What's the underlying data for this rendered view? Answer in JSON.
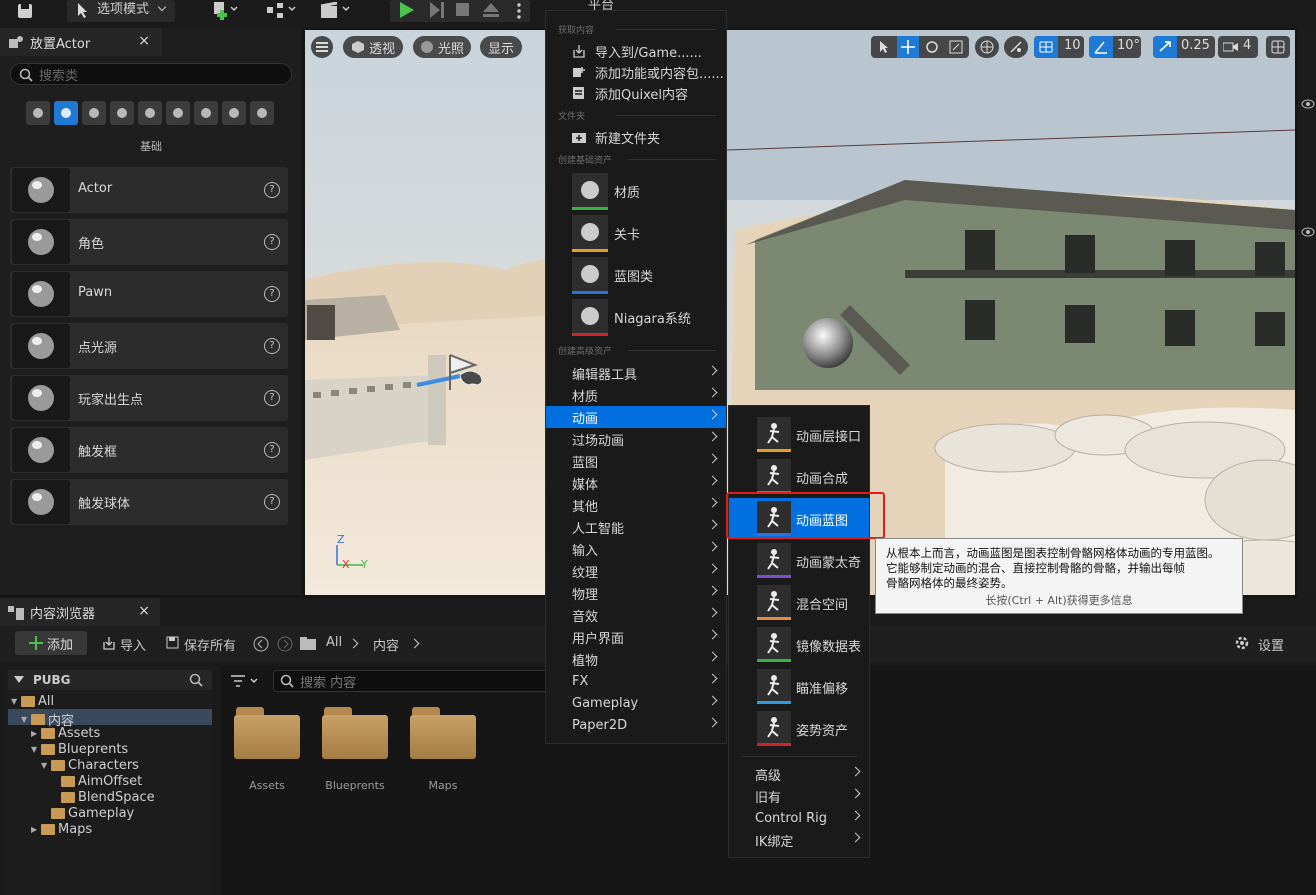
{
  "toolbar": {
    "mode_label": "选项模式",
    "platform_label": "平台"
  },
  "place_actor": {
    "tab_title": "放置Actor",
    "search_placeholder": "搜索类",
    "category_label": "基础",
    "categories": [
      "recent-icon",
      "basic-icon",
      "lights-icon",
      "shapes-icon",
      "cinematic-icon",
      "visual-effects-icon",
      "volumes-icon",
      "all-classes-icon",
      "geometry-icon"
    ],
    "items": [
      {
        "label": "Actor",
        "icon": "sphere-actor-icon"
      },
      {
        "label": "角色",
        "icon": "character-head-icon"
      },
      {
        "label": "Pawn",
        "icon": "pawn-icon"
      },
      {
        "label": "点光源",
        "icon": "lightbulb-icon"
      },
      {
        "label": "玩家出生点",
        "icon": "player-start-flag-icon"
      },
      {
        "label": "触发框",
        "icon": "trigger-box-icon"
      },
      {
        "label": "触发球体",
        "icon": "trigger-sphere-icon"
      }
    ]
  },
  "viewport": {
    "menu_icon": "hamburger-icon",
    "perspective_label": "透视",
    "lit_label": "光照",
    "show_label": "显示",
    "grid_value": "10",
    "rotation_value": "10°",
    "scale_value": "0.25",
    "camera_speed_value": "4",
    "axis_z": "Z",
    "axis_x": "X",
    "axis_y": "Y"
  },
  "content_browser": {
    "tab_title": "内容浏览器",
    "add_label": "添加",
    "import_label": "导入",
    "save_all_label": "保存所有",
    "crumbs": [
      "All",
      "内容"
    ],
    "settings_label": "设置",
    "project_name": "PUBG",
    "search_placeholder": "搜索 内容",
    "tree": [
      {
        "label": "All",
        "depth": 0,
        "expanded": true
      },
      {
        "label": "内容",
        "depth": 1,
        "expanded": true,
        "selected": true
      },
      {
        "label": "Assets",
        "depth": 2,
        "expanded": false
      },
      {
        "label": "Blueprents",
        "depth": 2,
        "expanded": true
      },
      {
        "label": "Characters",
        "depth": 3,
        "expanded": true
      },
      {
        "label": "AimOffset",
        "depth": 4
      },
      {
        "label": "BlendSpace",
        "depth": 4
      },
      {
        "label": "Gameplay",
        "depth": 3
      },
      {
        "label": "Maps",
        "depth": 2,
        "expanded": false
      }
    ],
    "folders": [
      "Assets",
      "Blueprents",
      "Maps"
    ]
  },
  "add_menu": {
    "section_get_content": "获取内容",
    "import_to": "导入到/Game......",
    "add_feature": "添加功能或内容包......",
    "add_quixel": "添加Quixel内容",
    "section_folder": "文件夹",
    "new_folder": "新建文件夹",
    "section_basic": "创建基础资产",
    "basic_assets": [
      {
        "label": "材质",
        "color": "#3cb043"
      },
      {
        "label": "关卡",
        "color": "#e5a021"
      },
      {
        "label": "蓝图类",
        "color": "#2c6fe0"
      },
      {
        "label": "Niagara系统",
        "color": "#d0252b"
      }
    ],
    "section_advanced": "创建高级资产",
    "advanced_items": [
      "编辑器工具",
      "材质",
      "动画",
      "过场动画",
      "蓝图",
      "媒体",
      "其他",
      "人工智能",
      "输入",
      "纹理",
      "物理",
      "音效",
      "用户界面",
      "植物",
      "FX",
      "Gameplay",
      "Paper2D"
    ],
    "highlighted_item": "动画"
  },
  "anim_menu": {
    "items": [
      {
        "label": "动画层接口",
        "color": "#e5a021",
        "icon": "anim-layer-interface-icon"
      },
      {
        "label": "动画合成",
        "color": "#3a86e8",
        "icon": "anim-montage-composite-icon"
      },
      {
        "label": "动画蓝图",
        "color": "#2c6fe0",
        "icon": "anim-blueprint-icon",
        "highlighted": true
      },
      {
        "label": "动画蒙太奇",
        "color": "#7b4fd6",
        "icon": "anim-montage-icon"
      },
      {
        "label": "混合空间",
        "color": "#e58c45",
        "icon": "blend-space-icon"
      },
      {
        "label": "镜像数据表",
        "color": "#3cb043",
        "icon": "mirror-table-icon"
      },
      {
        "label": "瞄准偏移",
        "color": "#2c9be0",
        "icon": "aim-offset-icon"
      },
      {
        "label": "姿势资产",
        "color": "#d0252b",
        "icon": "pose-asset-icon"
      }
    ],
    "sub_items": [
      "高级",
      "旧有",
      "Control Rig",
      "IK绑定"
    ]
  },
  "tooltip": {
    "line1": "从根本上而言，动画蓝图是图表控制骨骼网格体动画的专用蓝图。",
    "line2": "它能够制定动画的混合、直接控制骨骼的骨骼，并输出每帧",
    "line3": "骨骼网格体的最终姿势。",
    "hint": "长按(Ctrl + Alt)获得更多信息"
  }
}
